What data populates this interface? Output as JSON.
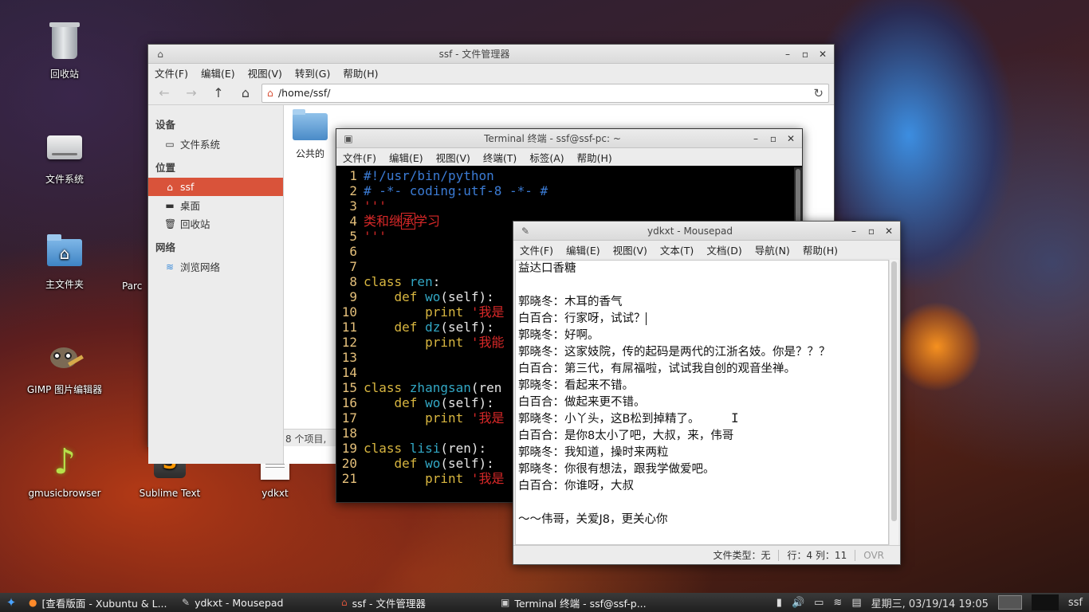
{
  "desktop": {
    "icons": [
      {
        "label": "回收站"
      },
      {
        "label": "文件系统"
      },
      {
        "label": "主文件夹"
      },
      {
        "label": "GIMP 图片编辑器"
      },
      {
        "label": "gmusicbrowser"
      },
      {
        "label": "Sublime Text"
      },
      {
        "label": "ydkxt"
      },
      {
        "label": "Parc"
      }
    ]
  },
  "file_manager": {
    "title": "ssf - 文件管理器",
    "menu": [
      "文件(F)",
      "编辑(E)",
      "视图(V)",
      "转到(G)",
      "帮助(H)"
    ],
    "path": "/home/ssf/",
    "sidebar": {
      "devices_header": "设备",
      "devices": [
        {
          "label": "文件系统"
        }
      ],
      "places_header": "位置",
      "places": [
        {
          "label": "ssf"
        },
        {
          "label": "桌面"
        },
        {
          "label": "回收站"
        }
      ],
      "network_header": "网络",
      "network": [
        {
          "label": "浏览网络"
        }
      ]
    },
    "folder": "公共的",
    "status": "8 个项目,"
  },
  "terminal": {
    "title": "Terminal 终端 - ssf@ssf-pc: ~",
    "menu": [
      "文件(F)",
      "编辑(E)",
      "视图(V)",
      "终端(T)",
      "标签(A)",
      "帮助(H)"
    ],
    "lines": [
      {
        "n": "1",
        "parts": [
          [
            "cmt",
            "#!/usr/bin/python"
          ]
        ]
      },
      {
        "n": "2",
        "parts": [
          [
            "cmt",
            "# -*- coding:utf-8 -*- #"
          ]
        ]
      },
      {
        "n": "3",
        "parts": [
          [
            "str",
            "'''"
          ]
        ]
      },
      {
        "n": "4",
        "parts": [
          [
            "str",
            "类和继"
          ],
          [
            "box",
            "承"
          ],
          [
            "str",
            "学习"
          ]
        ]
      },
      {
        "n": "5",
        "parts": [
          [
            "str",
            "'''"
          ]
        ]
      },
      {
        "n": "6",
        "parts": []
      },
      {
        "n": "7",
        "parts": []
      },
      {
        "n": "8",
        "parts": [
          [
            "kw",
            "class "
          ],
          [
            "name",
            "ren"
          ],
          [
            "txt",
            ":"
          ]
        ]
      },
      {
        "n": "9",
        "parts": [
          [
            "txt",
            "    "
          ],
          [
            "kw",
            "def "
          ],
          [
            "name",
            "wo"
          ],
          [
            "txt",
            "(self):"
          ]
        ]
      },
      {
        "n": "10",
        "parts": [
          [
            "txt",
            "        "
          ],
          [
            "kw",
            "print "
          ],
          [
            "str",
            "'我是"
          ]
        ]
      },
      {
        "n": "11",
        "parts": [
          [
            "txt",
            "    "
          ],
          [
            "kw",
            "def "
          ],
          [
            "name",
            "dz"
          ],
          [
            "txt",
            "(self):"
          ]
        ]
      },
      {
        "n": "12",
        "parts": [
          [
            "txt",
            "        "
          ],
          [
            "kw",
            "print "
          ],
          [
            "str",
            "'我能"
          ]
        ]
      },
      {
        "n": "13",
        "parts": []
      },
      {
        "n": "14",
        "parts": []
      },
      {
        "n": "15",
        "parts": [
          [
            "kw",
            "class "
          ],
          [
            "name",
            "zhangsan"
          ],
          [
            "txt",
            "(ren"
          ]
        ]
      },
      {
        "n": "16",
        "parts": [
          [
            "txt",
            "    "
          ],
          [
            "kw",
            "def "
          ],
          [
            "name",
            "wo"
          ],
          [
            "txt",
            "(self):"
          ]
        ]
      },
      {
        "n": "17",
        "parts": [
          [
            "txt",
            "        "
          ],
          [
            "kw",
            "print "
          ],
          [
            "str",
            "'我是"
          ]
        ]
      },
      {
        "n": "18",
        "parts": []
      },
      {
        "n": "19",
        "parts": [
          [
            "kw",
            "class "
          ],
          [
            "name",
            "lisi"
          ],
          [
            "txt",
            "(ren):"
          ]
        ]
      },
      {
        "n": "20",
        "parts": [
          [
            "txt",
            "    "
          ],
          [
            "kw",
            "def "
          ],
          [
            "name",
            "wo"
          ],
          [
            "txt",
            "(self):"
          ]
        ]
      },
      {
        "n": "21",
        "parts": [
          [
            "txt",
            "        "
          ],
          [
            "kw",
            "print "
          ],
          [
            "str",
            "'我是"
          ]
        ]
      }
    ]
  },
  "mousepad": {
    "title": "ydkxt - Mousepad",
    "menu": [
      "文件(F)",
      "编辑(E)",
      "视图(V)",
      "文本(T)",
      "文档(D)",
      "导航(N)",
      "帮助(H)"
    ],
    "lines": [
      "益达口香糖",
      "",
      "郭晓冬：木耳的香气",
      "白百合：行家呀，试试？",
      "郭晓冬：好啊。",
      "郭晓冬：这家妓院，传的起码是两代的江浙名妓。你是？？？",
      "白百合：第三代，有屌福啦，试试我自创的观音坐禅。",
      "郭晓冬：看起来不错。",
      "白百合：做起来更不错。",
      "郭晓冬：小丫头，这B松到掉精了。",
      "白百合：是你8太小了吧，大叔，来，伟哥",
      "郭晓冬：我知道，操时来两粒",
      "郭晓冬：你很有想法，跟我学做爱吧。",
      "白百合：你谁呀，大叔",
      "",
      "～～伟哥，关爱J8，更关心你"
    ],
    "caret_line": 3,
    "status": {
      "filetype": "文件类型：无",
      "position": "行：4 列：11",
      "ovr": "OVR"
    }
  },
  "taskbar": {
    "tasks": [
      {
        "label": "[查看版面 - Xubuntu & L..."
      },
      {
        "label": "ydkxt - Mousepad"
      },
      {
        "label": "ssf - 文件管理器"
      },
      {
        "label": "Terminal 终端 - ssf@ssf-p..."
      }
    ],
    "clock": "星期三, 03/19/14 19:05",
    "user": "ssf"
  }
}
